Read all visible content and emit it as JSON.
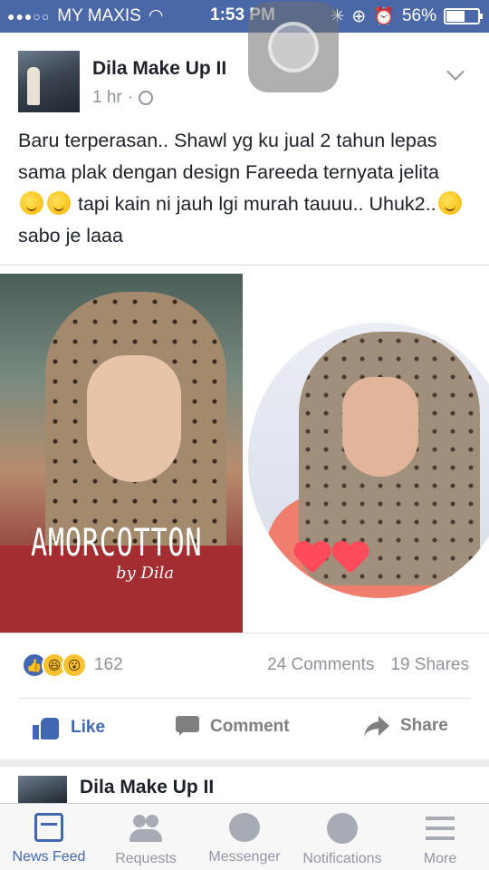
{
  "status_bar": {
    "carrier": "MY MAXIS",
    "time": "1:53 PM",
    "battery": "56%"
  },
  "post": {
    "author": "Dila Make Up II",
    "timestamp": "1 hr",
    "text_1": "Baru terperasan.. Shawl yg ku jual 2 tahun lepas sama plak dengan design Fareeda ternyata jelita",
    "text_2": "tapi kain ni jauh lgi murah tauuu.. Uhuk2..",
    "text_3": "sabo je laaa",
    "photo_brand": "AMORCOTTON",
    "photo_brand_sub": "by Dila",
    "reaction_count": "162",
    "comments": "24 Comments",
    "shares": "19 Shares",
    "actions": {
      "like": "Like",
      "comment": "Comment",
      "share": "Share"
    }
  },
  "next_post": {
    "author": "Dila Make Up II"
  },
  "tabbar": [
    {
      "label": "News Feed",
      "icon": "news-feed-icon",
      "active": true
    },
    {
      "label": "Requests",
      "icon": "friend-requests-icon",
      "active": false
    },
    {
      "label": "Messenger",
      "icon": "messenger-icon",
      "active": false
    },
    {
      "label": "Notifications",
      "icon": "globe-icon",
      "active": false
    },
    {
      "label": "More",
      "icon": "menu-icon",
      "active": false
    }
  ],
  "colors": {
    "brand": "#4267b2",
    "status_bar": "#4a67a8",
    "muted": "#90949c"
  }
}
